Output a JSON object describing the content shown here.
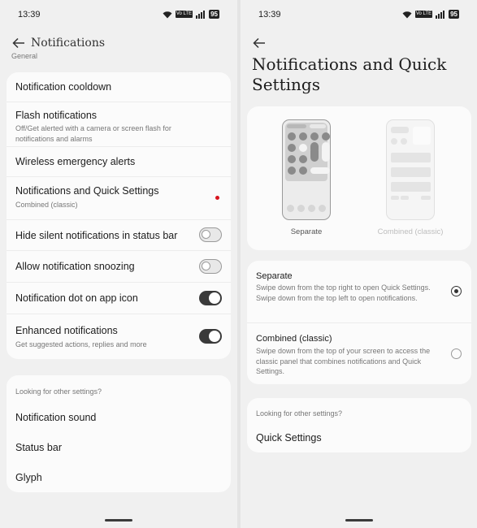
{
  "left": {
    "status": {
      "time": "13:39",
      "battery": "95",
      "volte": "Vo LTE"
    },
    "header": {
      "title": "Notifications",
      "section_peek": "General"
    },
    "main_list": [
      {
        "label": "Notification cooldown"
      },
      {
        "label": "Flash notifications",
        "sub": "Off/Get alerted with a camera or screen flash for notifications and alarms"
      },
      {
        "label": "Wireless emergency alerts"
      },
      {
        "label": "Notifications and Quick Settings",
        "sub": "Combined (classic)"
      },
      {
        "label": "Hide silent notifications in status bar",
        "toggle": false
      },
      {
        "label": "Allow notification snoozing",
        "toggle": false
      },
      {
        "label": "Notification dot on app icon",
        "toggle": true
      },
      {
        "label": "Enhanced notifications",
        "sub": "Get suggested actions, replies and more",
        "toggle": true
      }
    ],
    "other": {
      "caption": "Looking for other settings?",
      "items": [
        "Notification sound",
        "Status bar",
        "Glyph"
      ]
    }
  },
  "right": {
    "status": {
      "time": "13:39",
      "battery": "95",
      "volte": "Vo LTE"
    },
    "title": "Notifications and Quick Settings",
    "preview": {
      "separate_label": "Separate",
      "combined_label": "Combined (classic)"
    },
    "options": [
      {
        "title": "Separate",
        "desc": "Swipe down from the top right to open Quick Settings. Swipe down from the top left to open notifications.",
        "selected": true
      },
      {
        "title": "Combined (classic)",
        "desc": "Swipe down from the top of your screen to access the classic panel that combines notifications and Quick Settings.",
        "selected": false
      }
    ],
    "other": {
      "caption": "Looking for other settings?",
      "items": [
        "Quick Settings"
      ]
    }
  }
}
